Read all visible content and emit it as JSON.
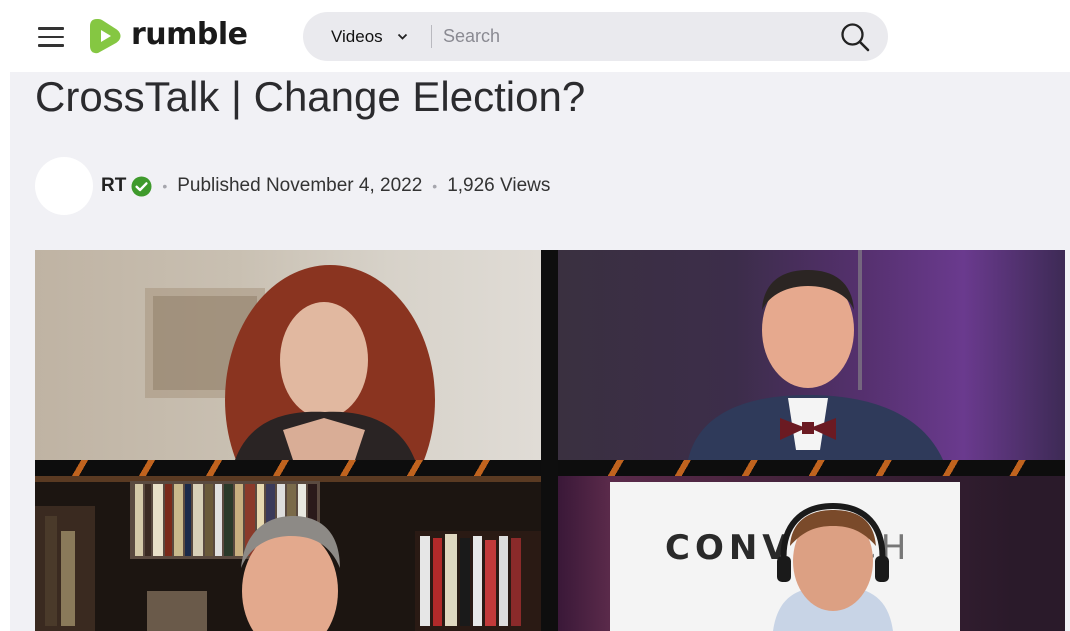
{
  "header": {
    "logo_text": "rumble",
    "brand_color": "#85c742",
    "search": {
      "category": "Videos",
      "placeholder": "Search"
    }
  },
  "video": {
    "title": "CrossTalk | Change Election?",
    "channel": "RT",
    "verified": true,
    "published": "Published November 4, 2022",
    "views": "1,926 Views",
    "thumbnail_overlay_text": "CONV      CH"
  },
  "icons": {
    "menu": "hamburger-menu-icon",
    "search": "search-icon",
    "verified": "verified-check-icon",
    "dropdown": "chevron-down-icon"
  }
}
